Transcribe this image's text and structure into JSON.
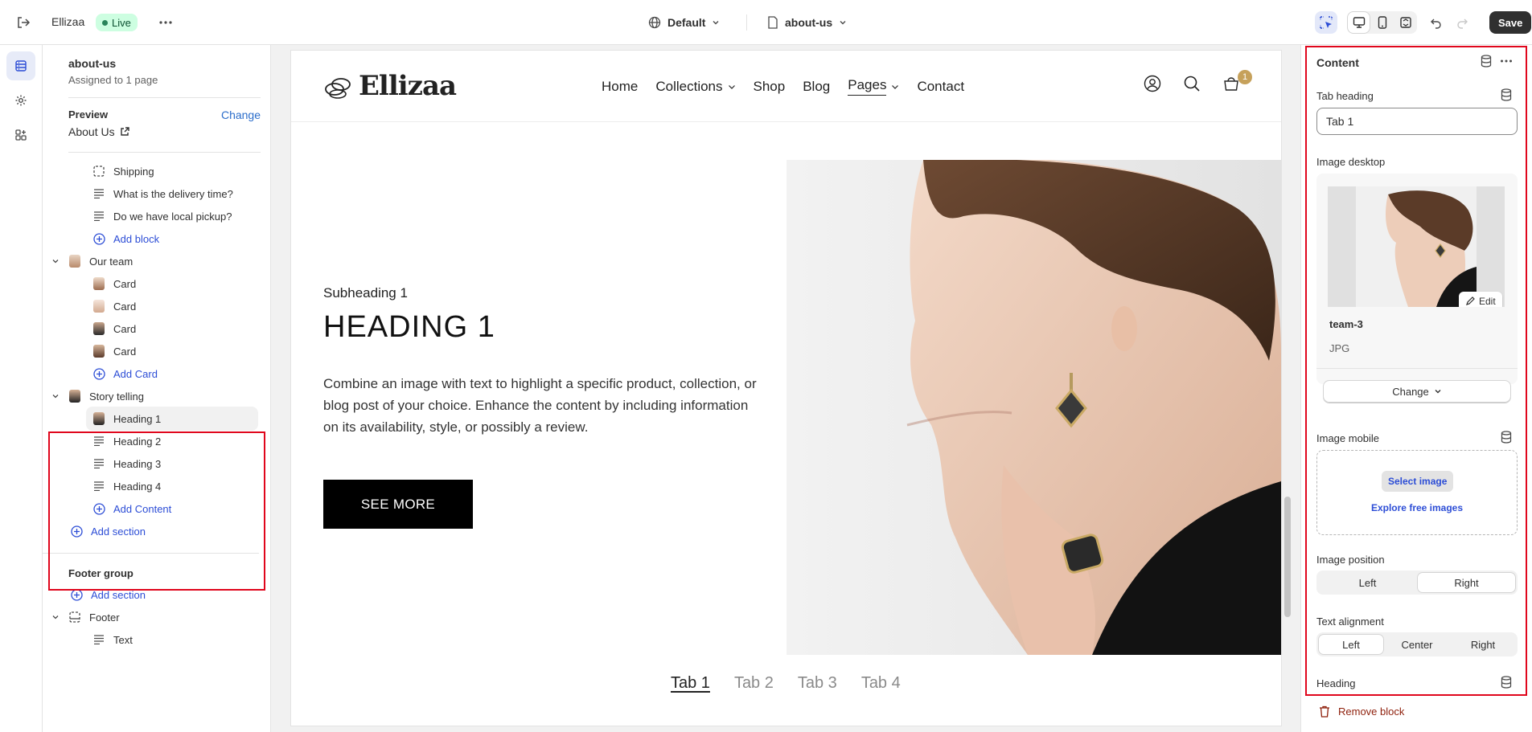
{
  "topbar": {
    "store_name": "Ellizaa",
    "live_badge": "Live",
    "theme_name": "Default",
    "page_name": "about-us",
    "save_label": "Save"
  },
  "left_panel": {
    "title": "about-us",
    "subtitle": "Assigned to 1 page",
    "preview_label": "Preview",
    "change_label": "Change",
    "preview_page": "About Us",
    "items": [
      {
        "label": "Shipping"
      },
      {
        "label": "What is the delivery time?"
      },
      {
        "label": "Do we have local pickup?"
      },
      {
        "label": "Add block"
      },
      {
        "label": "Our team"
      },
      {
        "label": "Card"
      },
      {
        "label": "Card"
      },
      {
        "label": "Card"
      },
      {
        "label": "Card"
      },
      {
        "label": "Add Card"
      },
      {
        "label": "Story telling"
      },
      {
        "label": "Heading 1"
      },
      {
        "label": "Heading 2"
      },
      {
        "label": "Heading 3"
      },
      {
        "label": "Heading 4"
      },
      {
        "label": "Add Content"
      },
      {
        "label": "Add section"
      }
    ],
    "footer_group_label": "Footer group",
    "footer_add_section": "Add section",
    "footer_label": "Footer",
    "footer_text": "Text"
  },
  "site": {
    "logo": "Ellizaa",
    "nav": [
      "Home",
      "Collections",
      "Shop",
      "Blog",
      "Pages",
      "Contact"
    ],
    "cart_count": "1",
    "subheading": "Subheading 1",
    "heading": "HEADING 1",
    "body": "Combine an image with text to highlight a specific product, collection, or blog post of your choice. Enhance the content by including information on its availability, style, or possibly a review.",
    "button": "SEE MORE",
    "tabs": [
      "Tab 1",
      "Tab 2",
      "Tab 3",
      "Tab 4"
    ]
  },
  "right_panel": {
    "title": "Content",
    "tab_heading_label": "Tab heading",
    "tab_heading_value": "Tab 1",
    "image_desktop_label": "Image desktop",
    "edit_label": "Edit",
    "image_name": "team-3",
    "image_type": "JPG",
    "change_label": "Change",
    "image_mobile_label": "Image mobile",
    "select_image": "Select image",
    "explore_free": "Explore free images",
    "image_position_label": "Image position",
    "image_position_options": [
      "Left",
      "Right"
    ],
    "text_alignment_label": "Text alignment",
    "text_alignment_options": [
      "Left",
      "Center",
      "Right"
    ],
    "heading_label": "Heading",
    "remove_block": "Remove block"
  },
  "colors": {
    "accent_red": "#e0061c",
    "link_blue": "#2c4dd6",
    "live_green": "#29845a",
    "cart_badge": "#c6a15b"
  }
}
